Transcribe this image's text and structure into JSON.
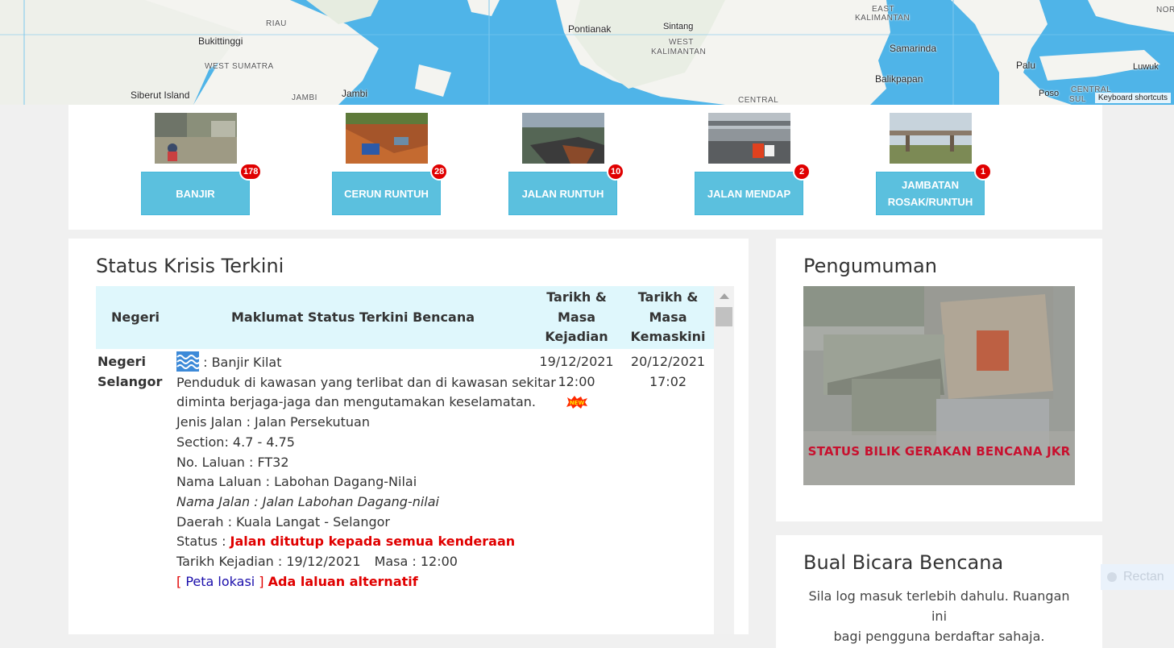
{
  "map": {
    "labels": {
      "riau": "RIAU",
      "bukittinggi": "Bukittinggi",
      "west_sumatra": "WEST SUMATRA",
      "siberut": "Siberut Island",
      "jambi_region": "JAMBI",
      "jambi_city": "Jambi",
      "pontianak": "Pontianak",
      "sintang": "Sintang",
      "west_kalimantan_1": "WEST",
      "west_kalimantan_2": "KALIMANTAN",
      "central": "CENTRAL",
      "east_kalimantan_1": "EAST",
      "east_kalimantan_2": "KALIMANTAN",
      "samarinda": "Samarinda",
      "balikpapan": "Balikpapan",
      "palu": "Palu",
      "luwuk": "Luwuk",
      "poso": "Poso",
      "central_sul_1": "CENTRAL",
      "central_sul_2": "SUL",
      "nor": "NOR"
    },
    "keyboard_shortcuts": "Keyboard shortcuts"
  },
  "categories": [
    {
      "label": "BANJIR",
      "count": "178"
    },
    {
      "label": "CERUN RUNTUH",
      "count": "28"
    },
    {
      "label": "JALAN RUNTUH",
      "count": "10"
    },
    {
      "label": "JALAN MENDAP",
      "count": "2"
    },
    {
      "label": "JAMBATAN ROSAK/RUNTUH",
      "count": "1"
    }
  ],
  "status": {
    "title": "Status Krisis Terkini",
    "columns": {
      "negeri": "Negeri",
      "maklumat": "Maklumat Status Terkini Bencana",
      "tarikh_kejadian": "Tarikh & Masa Kejadian",
      "tarikh_kemaskini": "Tarikh & Masa Kemaskini"
    },
    "rows": [
      {
        "negeri": "Negeri Selangor",
        "type": ": Banjir Kilat",
        "desc1": "Penduduk di kawasan yang terlibat dan di kawasan sekitar",
        "desc2": "diminta berjaga-jaga dan mengutamakan keselamatan.",
        "jenis_jalan": "Jenis Jalan : Jalan Persekutuan",
        "section": "Section: 4.7 - 4.75",
        "no_laluan": "No. Laluan : FT32",
        "nama_laluan": "Nama Laluan : Labohan Dagang-Nilai",
        "nama_jalan": "Nama Jalan : Jalan Labohan Dagang-nilai",
        "daerah": "Daerah : Kuala Langat - Selangor",
        "status_label": "Status : ",
        "status_value": "Jalan ditutup kepada semua kenderaan",
        "tarikh_kejadian_text": "Tarikh Kejadian : 19/12/2021",
        "masa_text": "Masa : 12:00",
        "bracket_open": "[ ",
        "peta_lokasi": "Peta lokasi",
        "bracket_close": " ]",
        "alternatif": "Ada laluan alternatif",
        "kejadian_date": "19/12/2021",
        "kejadian_time": "12:00",
        "new_label": "NEW",
        "kemaskini_date": "20/12/2021",
        "kemaskini_time": "17:02"
      }
    ]
  },
  "announcement": {
    "title": "Pengumuman",
    "caption": "STATUS BILIK GERAKAN BENCANA JKR"
  },
  "bual": {
    "title": "Bual Bicara Bencana",
    "text1": "Sila log masuk terlebih dahulu. Ruangan ini",
    "text2": "bagi pengguna berdaftar sahaja."
  },
  "ghost": {
    "label": "Rectan"
  },
  "colors": {
    "accent_button": "#5bc0de",
    "badge": "#e00000",
    "table_header": "#dff7fc",
    "map_water": "#4fb4e8"
  }
}
